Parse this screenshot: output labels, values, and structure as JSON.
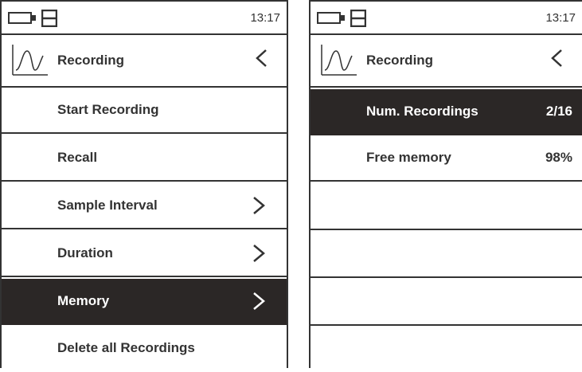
{
  "left": {
    "status": {
      "time": "13:17"
    },
    "header": {
      "title": "Recording"
    },
    "items": [
      {
        "label": "Start Recording"
      },
      {
        "label": "Recall"
      },
      {
        "label": "Sample Interval"
      },
      {
        "label": "Duration"
      },
      {
        "label": "Memory"
      },
      {
        "label": "Delete all Recordings"
      }
    ]
  },
  "right": {
    "status": {
      "time": "13:17"
    },
    "header": {
      "title": "Recording"
    },
    "items": [
      {
        "label": "Num. Recordings",
        "value": "2/16"
      },
      {
        "label": "Free memory",
        "value": "98%"
      }
    ]
  },
  "colors": {
    "selected_bg": "#2b2726",
    "foreground": "#333333",
    "background": "#ffffff"
  }
}
